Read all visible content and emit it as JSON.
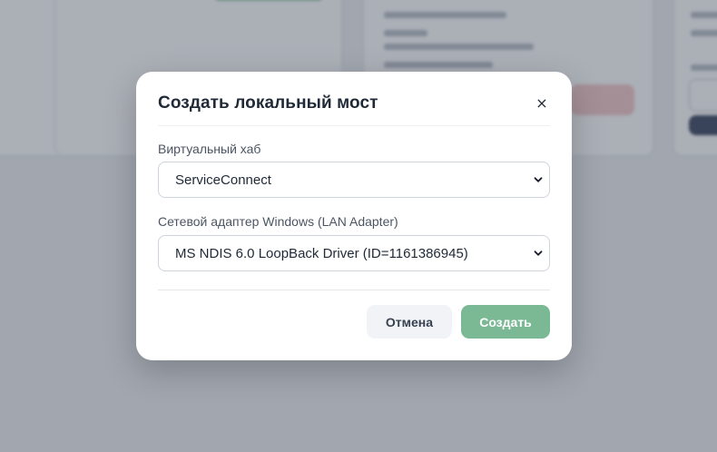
{
  "modal": {
    "title": "Создать локальный мост",
    "close_label": "×",
    "hub_label": "Виртуальный хаб",
    "hub_value": "ServiceConnect",
    "adapter_label": "Сетевой адаптер Windows (LAN Adapter)",
    "adapter_value": "MS NDIS 6.0 LoopBack Driver (ID=1161386945)",
    "cancel_label": "Отмена",
    "create_label": "Создать"
  },
  "colors": {
    "accent_green": "#7ab994",
    "cancel_bg": "#f1f3f6",
    "overlay": "rgba(55,65,81,0.42)"
  },
  "icons": {
    "close": "close-icon",
    "select_arrow": "chevron-down-icon"
  }
}
